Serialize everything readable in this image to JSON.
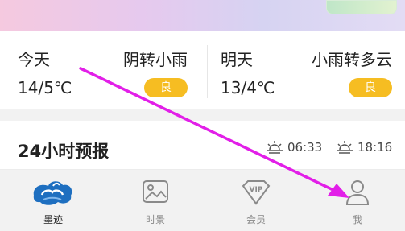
{
  "weather": {
    "today": {
      "label": "今天",
      "condition": "阴转小雨",
      "temp": "14/5℃",
      "aqi": "良"
    },
    "tomorrow": {
      "label": "明天",
      "condition": "小雨转多云",
      "temp": "13/4℃",
      "aqi": "良"
    }
  },
  "hourly": {
    "title": "24小时预报",
    "sunrise": "06:33",
    "sunset": "18:16"
  },
  "tabs": [
    {
      "label": "墨迹",
      "icon": "moji-logo-icon",
      "active": true
    },
    {
      "label": "时景",
      "icon": "photo-icon",
      "active": false
    },
    {
      "label": "会员",
      "icon": "vip-icon",
      "active": false
    },
    {
      "label": "我",
      "icon": "user-icon",
      "active": false
    }
  ],
  "colors": {
    "aqi_badge": "#f6bd22",
    "annotation_arrow": "#e21fe8",
    "logo_blue": "#1e6fc0"
  }
}
